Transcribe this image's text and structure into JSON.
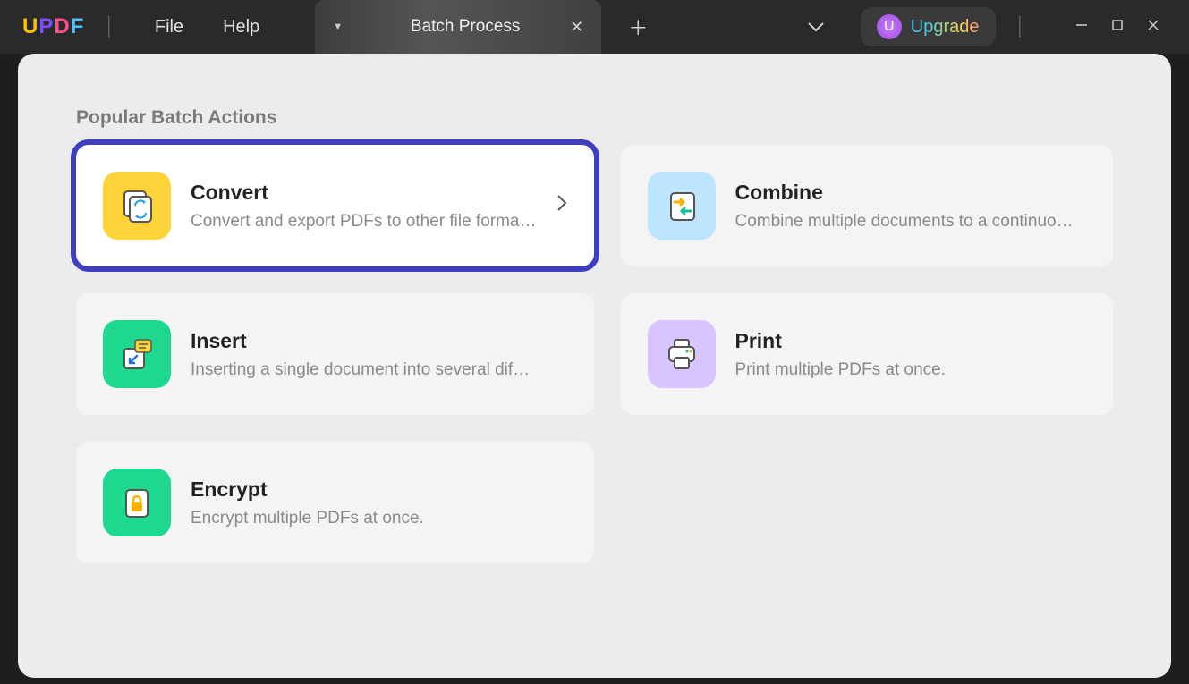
{
  "logo": {
    "l1": "U",
    "l2": "P",
    "l3": "D",
    "l4": "F"
  },
  "menu": {
    "file": "File",
    "help": "Help"
  },
  "tab": {
    "title": "Batch Process"
  },
  "upgrade": {
    "avatar": "U",
    "label": "Upgrade"
  },
  "section": {
    "title": "Popular Batch Actions"
  },
  "cards": {
    "convert": {
      "title": "Convert",
      "desc": "Convert and export PDFs to other file forma…"
    },
    "combine": {
      "title": "Combine",
      "desc": "Combine multiple documents to a continuo…"
    },
    "insert": {
      "title": "Insert",
      "desc": "Inserting a single document into several dif…"
    },
    "print": {
      "title": "Print",
      "desc": "Print multiple PDFs at once."
    },
    "encrypt": {
      "title": "Encrypt",
      "desc": "Encrypt multiple PDFs at once."
    }
  }
}
